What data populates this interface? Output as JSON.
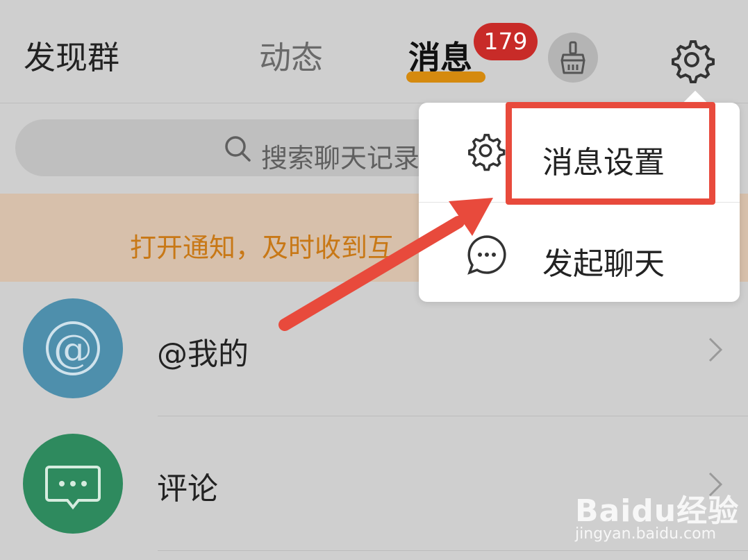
{
  "header": {
    "left_title": "发现群",
    "tabs": [
      {
        "label": "动态",
        "active": false
      },
      {
        "label": "消息",
        "active": true
      }
    ],
    "badge_count": "179",
    "clean_icon": "broom-icon",
    "settings_icon": "gear-icon"
  },
  "search": {
    "placeholder": "搜索聊天记录"
  },
  "banner": {
    "text": "打开通知，及时收到互"
  },
  "list": [
    {
      "label": "@我的",
      "icon": "at-icon",
      "color": "#4e8fac"
    },
    {
      "label": "评论",
      "icon": "comment-icon",
      "color": "#2e8a5e"
    }
  ],
  "menu": {
    "items": [
      {
        "label": "消息设置",
        "icon": "gear-icon"
      },
      {
        "label": "发起聊天",
        "icon": "chat-bubble-icon"
      }
    ]
  },
  "watermark": {
    "logo": "Baidu经验",
    "url": "jingyan.baidu.com"
  },
  "colors": {
    "accent": "#d58a0f",
    "badge": "#c82b28",
    "annotation": "#e84a3c",
    "banner_text": "#c87816"
  }
}
